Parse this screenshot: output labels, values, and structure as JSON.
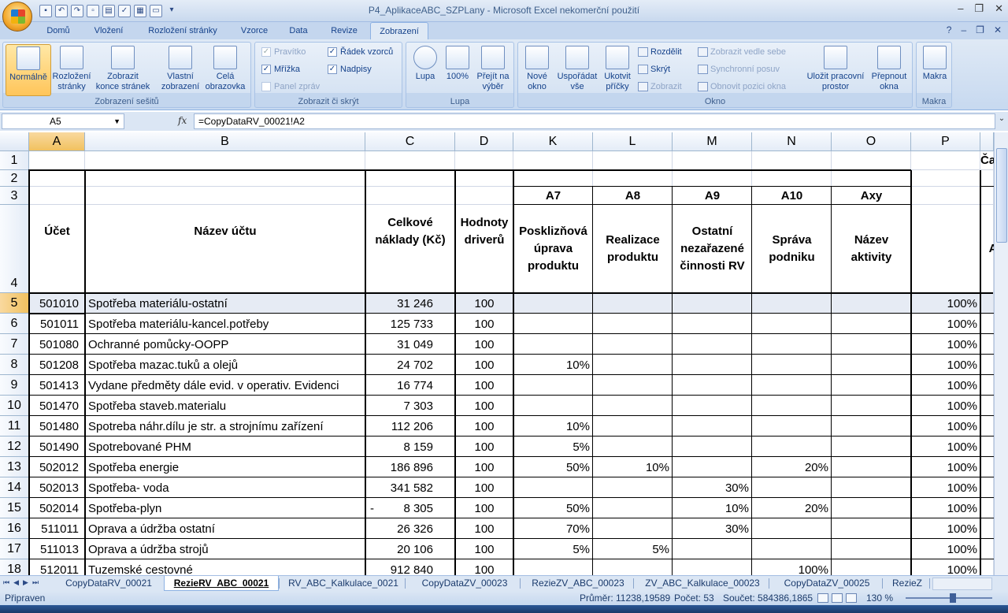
{
  "window": {
    "title": "P4_AplikaceABC_SZPLany - Microsoft Excel nekomerční použití",
    "controls": [
      "–",
      "❐",
      "✕"
    ],
    "help_controls": [
      "?",
      "–",
      "❐",
      "✕"
    ]
  },
  "ribbon_tabs": [
    "Domů",
    "Vložení",
    "Rozložení stránky",
    "Vzorce",
    "Data",
    "Revize",
    "Zobrazení"
  ],
  "active_tab": "Zobrazení",
  "ribbon": {
    "group_workbook_views": {
      "label": "Zobrazení sešitů",
      "buttons": [
        "Normálně",
        "Rozložení stránky",
        "Zobrazit konce stránek",
        "Vlastní zobrazení",
        "Celá obrazovka"
      ]
    },
    "group_show_hide": {
      "label": "Zobrazit či skrýt",
      "ruler": "Pravítko",
      "gridlines": "Mřížka",
      "messages": "Panel zpráv",
      "formula_bar": "Řádek vzorců",
      "headings": "Nadpisy"
    },
    "group_zoom": {
      "label": "Lupa",
      "buttons": [
        "Lupa",
        "100%",
        "Přejít na výběr"
      ]
    },
    "group_window": {
      "label": "Okno",
      "buttons": [
        "Nové okno",
        "Uspořádat vše",
        "Ukotvit příčky"
      ],
      "small": [
        "Rozdělit",
        "Skrýt",
        "Zobrazit",
        "Zobrazit vedle sebe",
        "Synchronní posuv",
        "Obnovit pozici okna"
      ],
      "big2": [
        "Uložit pracovní prostor",
        "Přepnout okna"
      ]
    },
    "group_macros": {
      "label": "Makra",
      "buttons": [
        "Makra"
      ]
    }
  },
  "formula_bar": {
    "name_box": "A5",
    "fx": "fx",
    "formula": "=CopyDataRV_00021!A2"
  },
  "columns": [
    "A",
    "B",
    "C",
    "D",
    "K",
    "L",
    "M",
    "N",
    "O",
    "P"
  ],
  "row_numbers": [
    "1",
    "2",
    "3",
    "4",
    "5",
    "6",
    "7",
    "8",
    "9",
    "10",
    "11",
    "12",
    "13",
    "14",
    "15",
    "16",
    "17",
    "18"
  ],
  "header": {
    "ucet": "Účet",
    "nazev_uctu": "Název účtu",
    "celkove_naklady": "Celkové náklady (Kč)",
    "hodnoty_driveru": "Hodnoty driverů",
    "activities": [
      {
        "code": "A7",
        "name": "Posklizňová úprava produktu"
      },
      {
        "code": "A8",
        "name": "Realizace produktu"
      },
      {
        "code": "A9",
        "name": "Ostatní nezařazené činnosti RV"
      },
      {
        "code": "A10",
        "name": "Správa podniku"
      },
      {
        "code": "Axy",
        "name": "Název aktivity"
      }
    ],
    "partial_q1": "Ča",
    "partial_q4": "A"
  },
  "rows": [
    {
      "ucet": "501010",
      "nazev": "Spotřeba materiálu-ostatní",
      "naklady": "31 246",
      "dash": "",
      "driver": "100",
      "k": "",
      "l": "",
      "m": "",
      "n": "",
      "o": "",
      "p": "100%"
    },
    {
      "ucet": "501011",
      "nazev": "Spotřeba materiálu-kancel.potřeby",
      "naklady": "125 733",
      "dash": "",
      "driver": "100",
      "k": "",
      "l": "",
      "m": "",
      "n": "",
      "o": "",
      "p": "100%"
    },
    {
      "ucet": "501080",
      "nazev": "Ochranné pomůcky-OOPP",
      "naklady": "31 049",
      "dash": "",
      "driver": "100",
      "k": "",
      "l": "",
      "m": "",
      "n": "",
      "o": "",
      "p": "100%"
    },
    {
      "ucet": "501208",
      "nazev": "Spotřeba mazac.tuků a olejů",
      "naklady": "24 702",
      "dash": "",
      "driver": "100",
      "k": "10%",
      "l": "",
      "m": "",
      "n": "",
      "o": "",
      "p": "100%"
    },
    {
      "ucet": "501413",
      "nazev": "Vydane předměty dále evid. v operativ. Evidenci",
      "naklady": "16 774",
      "dash": "",
      "driver": "100",
      "k": "",
      "l": "",
      "m": "",
      "n": "",
      "o": "",
      "p": "100%"
    },
    {
      "ucet": "501470",
      "nazev": "Spotřeba staveb.materialu",
      "naklady": "7 303",
      "dash": "",
      "driver": "100",
      "k": "",
      "l": "",
      "m": "",
      "n": "",
      "o": "",
      "p": "100%"
    },
    {
      "ucet": "501480",
      "nazev": "Spotreba náhr.dílu je str. a strojnímu zařízení",
      "naklady": "112 206",
      "dash": "",
      "driver": "100",
      "k": "10%",
      "l": "",
      "m": "",
      "n": "",
      "o": "",
      "p": "100%"
    },
    {
      "ucet": "501490",
      "nazev": "Spotrebované PHM",
      "naklady": "8 159",
      "dash": "",
      "driver": "100",
      "k": "5%",
      "l": "",
      "m": "",
      "n": "",
      "o": "",
      "p": "100%"
    },
    {
      "ucet": "502012",
      "nazev": "Spotřeba energie",
      "naklady": "186 896",
      "dash": "",
      "driver": "100",
      "k": "50%",
      "l": "10%",
      "m": "",
      "n": "20%",
      "o": "",
      "p": "100%"
    },
    {
      "ucet": "502013",
      "nazev": "Spotřeba- voda",
      "naklady": "341 582",
      "dash": "",
      "driver": "100",
      "k": "",
      "l": "",
      "m": "30%",
      "n": "",
      "o": "",
      "p": "100%"
    },
    {
      "ucet": "502014",
      "nazev": "Spotřeba-plyn",
      "naklady": "8 305",
      "dash": "-",
      "driver": "100",
      "k": "50%",
      "l": "",
      "m": "10%",
      "n": "20%",
      "o": "",
      "p": "100%"
    },
    {
      "ucet": "511011",
      "nazev": "Oprava a údržba ostatní",
      "naklady": "26 326",
      "dash": "",
      "driver": "100",
      "k": "70%",
      "l": "",
      "m": "30%",
      "n": "",
      "o": "",
      "p": "100%"
    },
    {
      "ucet": "511013",
      "nazev": "Oprava a údržba strojů",
      "naklady": "20 106",
      "dash": "",
      "driver": "100",
      "k": "5%",
      "l": "5%",
      "m": "",
      "n": "",
      "o": "",
      "p": "100%"
    },
    {
      "ucet": "512011",
      "nazev": "Tuzemské cestovné",
      "naklady": "912 840",
      "dash": "",
      "driver": "100",
      "k": "",
      "l": "",
      "m": "",
      "n": "100%",
      "o": "",
      "p": "100%"
    }
  ],
  "sheet_tabs": [
    "CopyDataRV_00021",
    "RezieRV_ABC_00021",
    "RV_ABC_Kalkulace_0021",
    "CopyDataZV_00023",
    "RezieZV_ABC_00023",
    "ZV_ABC_Kalkulace_00023",
    "CopyDataZV_00025",
    "RezieZ"
  ],
  "active_sheet": "RezieRV_ABC_00021",
  "status": {
    "ready": "Připraven",
    "average": "Průměr: 11238,19589",
    "count": "Počet: 53",
    "sum": "Součet: 584386,1865",
    "zoom": "130 %"
  },
  "colors": {
    "ribbon_bg": "#dfe9f5",
    "selected_header": "#f1c15f",
    "gridline": "#d0d7e5"
  }
}
